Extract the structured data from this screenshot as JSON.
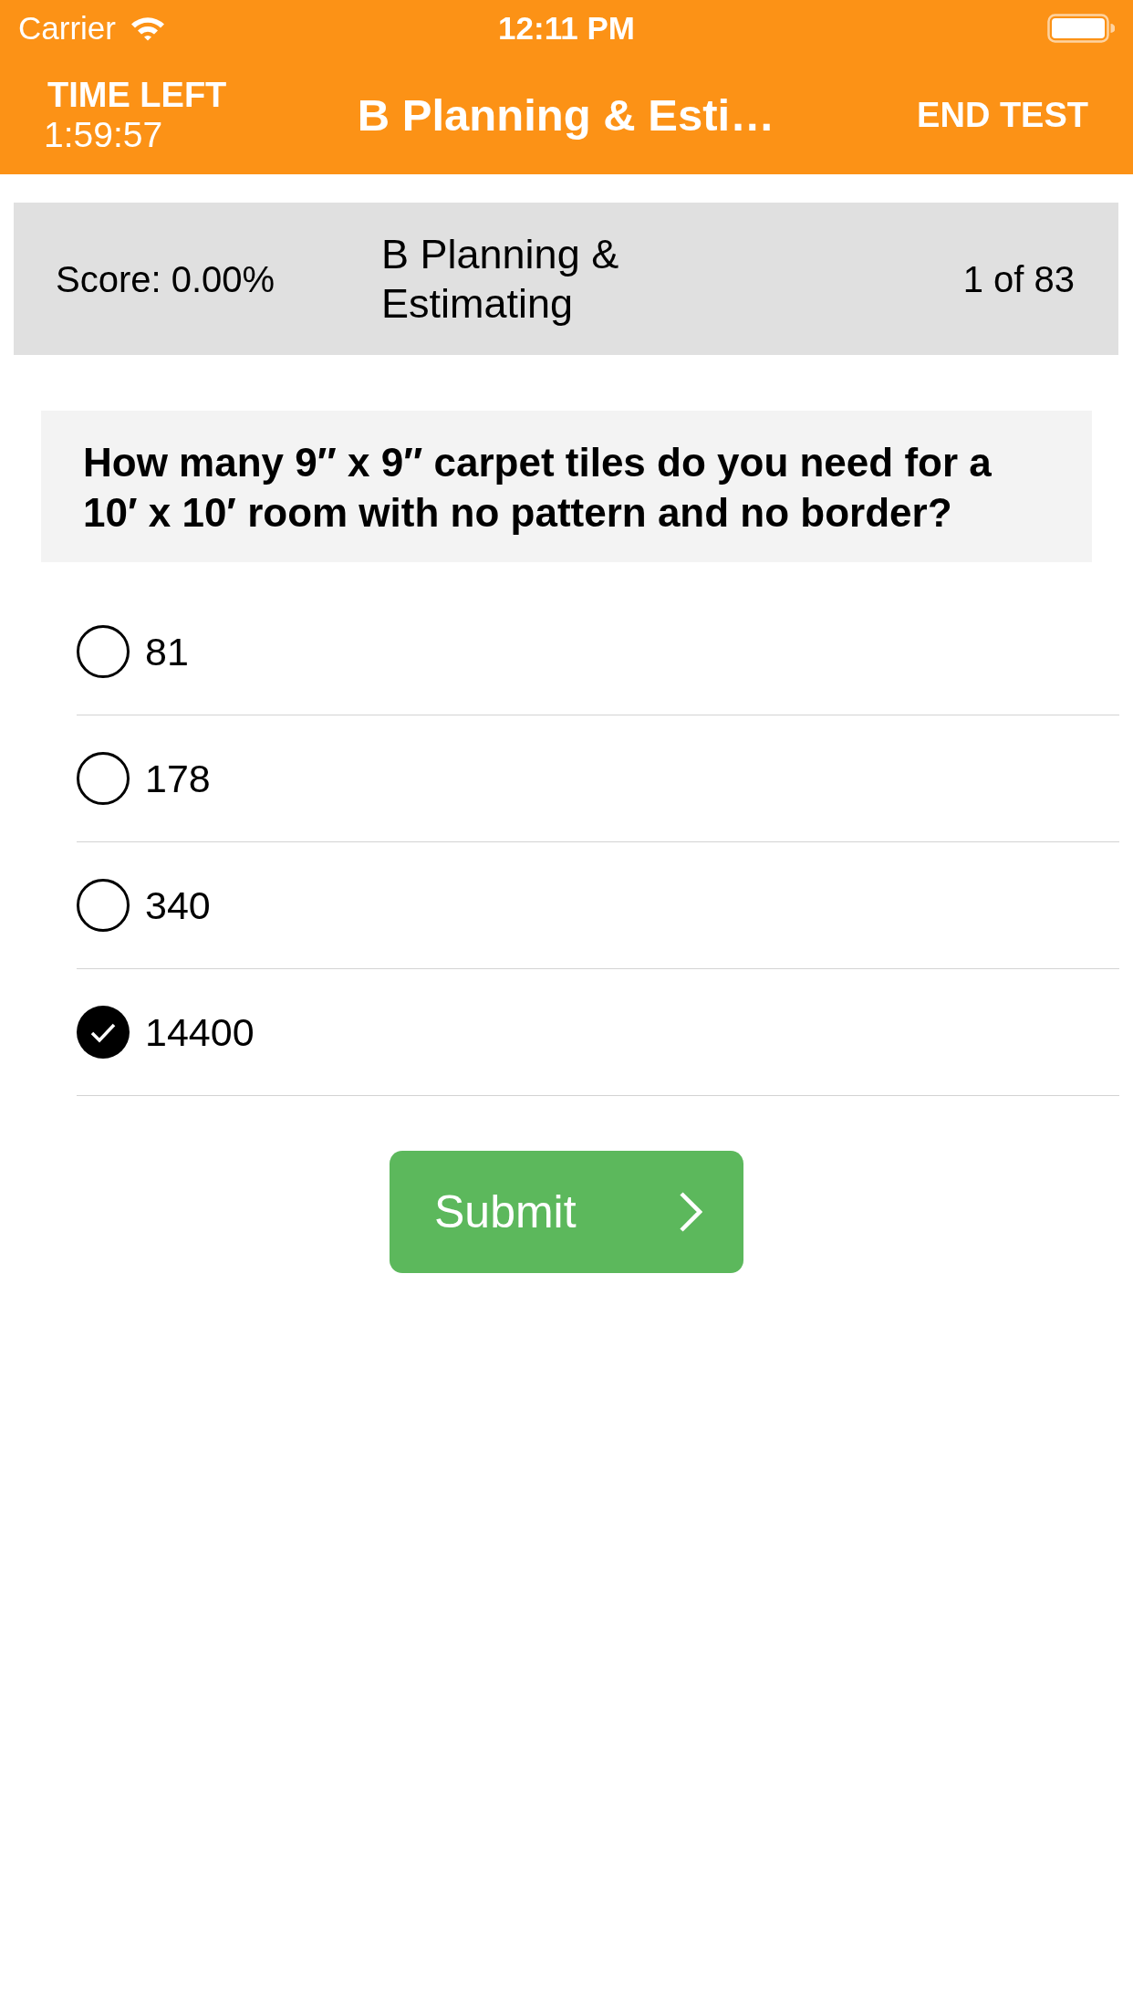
{
  "status_bar": {
    "carrier": "Carrier",
    "time": "12:11 PM"
  },
  "header": {
    "timer_label": "TIME LEFT",
    "timer_value": "1:59:57",
    "title": "B Planning & Esti…",
    "end_button": "END TEST"
  },
  "info_bar": {
    "score": "Score: 0.00%",
    "category": "B Planning & Estimating",
    "progress": "1 of 83"
  },
  "question": {
    "text": "How many 9″ x 9″ carpet tiles do you need for a 10′ x 10′ room with no pattern and no border?"
  },
  "options": [
    {
      "label": "81",
      "selected": false
    },
    {
      "label": "178",
      "selected": false
    },
    {
      "label": "340",
      "selected": false
    },
    {
      "label": "14400",
      "selected": true
    }
  ],
  "submit_button": {
    "label": "Submit"
  }
}
